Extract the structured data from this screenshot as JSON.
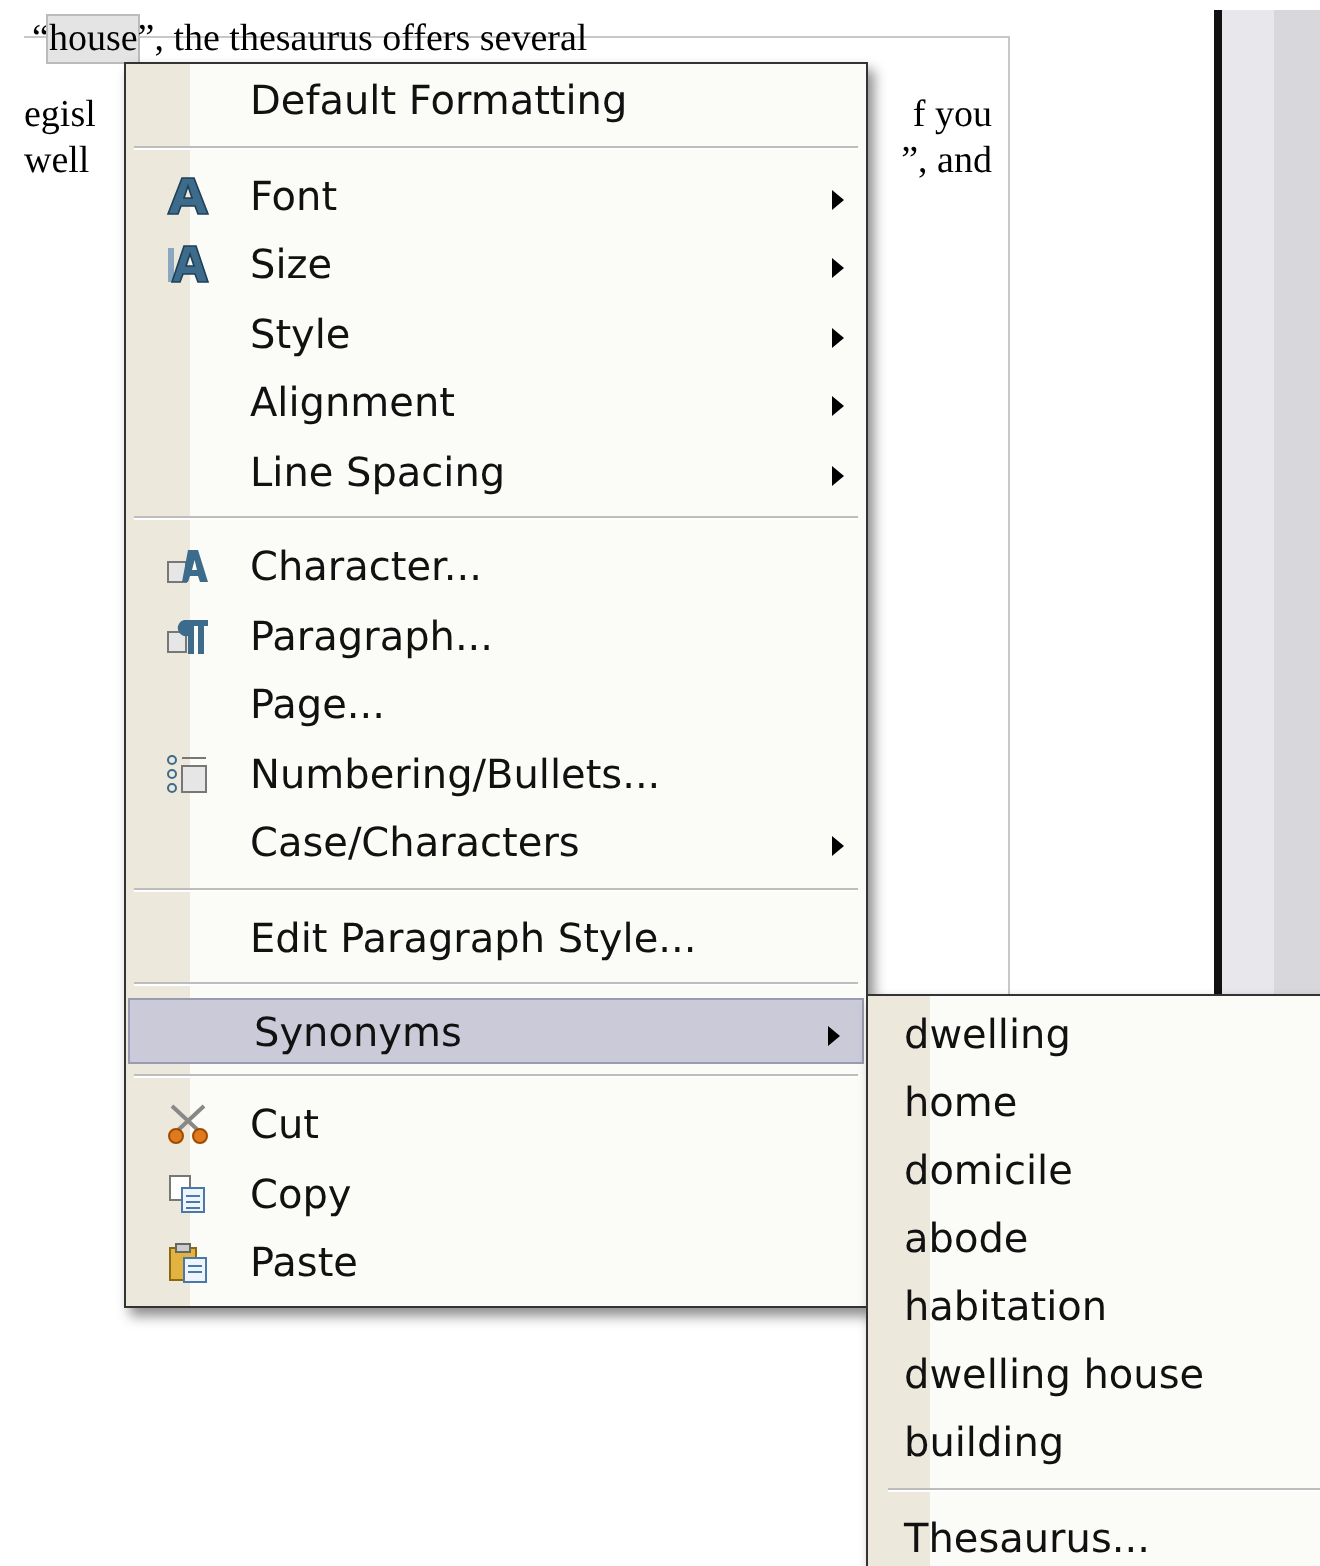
{
  "document": {
    "lines": [
      {
        "left": [
          "“",
          "house",
          "”, the thesaurus offers several"
        ]
      },
      {
        "left": [
          "egisl"
        ],
        "right": "f you"
      },
      {
        "left": [
          "well"
        ],
        "right": "”, and"
      }
    ]
  },
  "context_menu": {
    "items": [
      {
        "kind": "item",
        "label": "Default Formatting",
        "submenu": false,
        "selected": false
      },
      {
        "kind": "separator"
      },
      {
        "kind": "item",
        "label": "Font",
        "submenu": true,
        "selected": false
      },
      {
        "kind": "item",
        "label": "Size",
        "submenu": true,
        "selected": false
      },
      {
        "kind": "item",
        "label": "Style",
        "submenu": true,
        "selected": false
      },
      {
        "kind": "item",
        "label": "Alignment",
        "submenu": true,
        "selected": false
      },
      {
        "kind": "item",
        "label": "Line Spacing",
        "submenu": true,
        "selected": false
      },
      {
        "kind": "separator"
      },
      {
        "kind": "item",
        "label": "Character...",
        "submenu": false,
        "selected": false
      },
      {
        "kind": "item",
        "label": "Paragraph...",
        "submenu": false,
        "selected": false
      },
      {
        "kind": "item",
        "label": "Page...",
        "submenu": false,
        "selected": false
      },
      {
        "kind": "item",
        "label": "Numbering/Bullets...",
        "submenu": false,
        "selected": false
      },
      {
        "kind": "item",
        "label": "Case/Characters",
        "submenu": true,
        "selected": false
      },
      {
        "kind": "separator"
      },
      {
        "kind": "item",
        "label": "Edit Paragraph Style...",
        "submenu": false,
        "selected": false
      },
      {
        "kind": "separator"
      },
      {
        "kind": "item",
        "label": "Synonyms",
        "submenu": true,
        "selected": true
      },
      {
        "kind": "separator"
      },
      {
        "kind": "item",
        "label": "Cut",
        "submenu": false,
        "selected": false
      },
      {
        "kind": "item",
        "label": "Copy",
        "submenu": false,
        "selected": false
      },
      {
        "kind": "item",
        "label": "Paste",
        "submenu": false,
        "selected": false
      }
    ]
  },
  "synonyms_submenu": {
    "items": [
      {
        "kind": "item",
        "label": "dwelling",
        "selected": false
      },
      {
        "kind": "item",
        "label": "home",
        "selected": false
      },
      {
        "kind": "item",
        "label": "domicile",
        "selected": false
      },
      {
        "kind": "item",
        "label": "abode",
        "selected": false
      },
      {
        "kind": "item",
        "label": "habitation",
        "selected": false
      },
      {
        "kind": "item",
        "label": "dwelling house",
        "selected": false
      },
      {
        "kind": "item",
        "label": "building",
        "selected": false
      },
      {
        "kind": "separator"
      },
      {
        "kind": "item",
        "label": "Thesaurus...",
        "selected": false
      }
    ]
  }
}
